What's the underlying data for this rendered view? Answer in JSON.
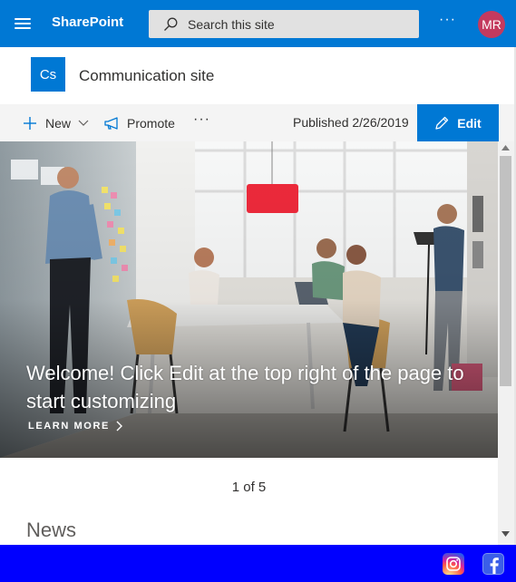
{
  "suite_bar": {
    "brand": "SharePoint",
    "search_placeholder": "Search this site",
    "more_label": "···",
    "avatar_initials": "MR",
    "colors": {
      "bar": "#0078d4",
      "avatar": "#c43a5e"
    }
  },
  "site": {
    "logo_initials": "Cs",
    "title": "Communication site"
  },
  "command_bar": {
    "new_label": "New",
    "promote_label": "Promote",
    "more_label": "···",
    "published": "Published 2/26/2019",
    "edit_label": "Edit"
  },
  "hero": {
    "title": "Welcome! Click Edit at the top right of the page to start customizing",
    "link": "LEARN MORE",
    "pager": "1 of 5"
  },
  "sections": {
    "news_title": "News"
  },
  "footer": {
    "icons": [
      "instagram-icon",
      "facebook-icon"
    ],
    "color": "#0000ff"
  }
}
